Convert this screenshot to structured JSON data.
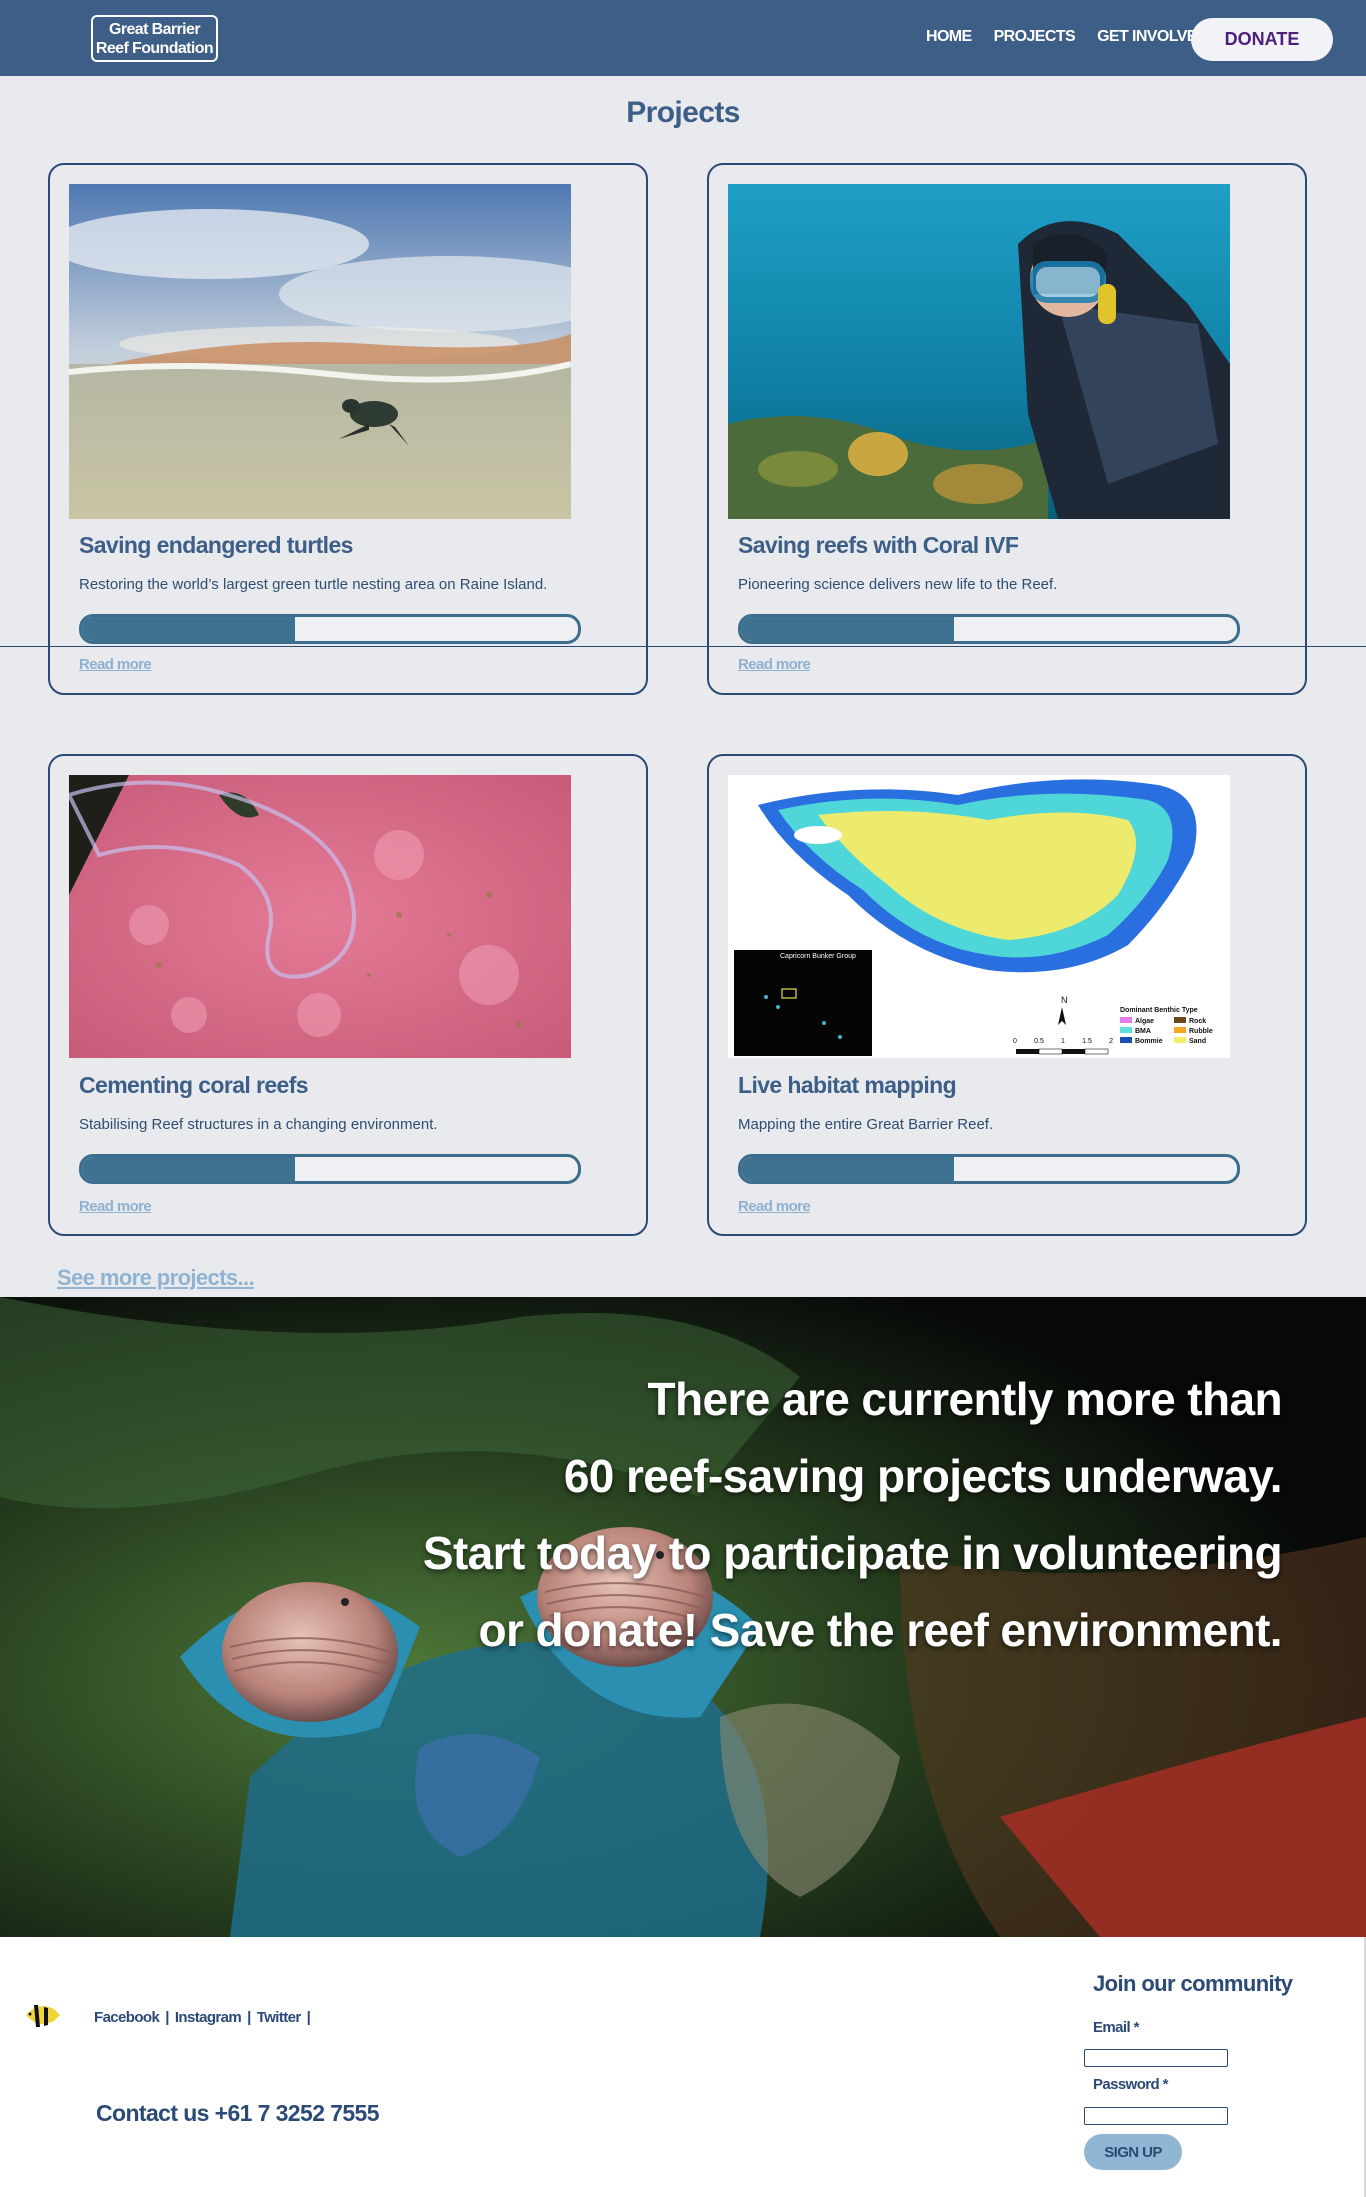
{
  "header": {
    "logo_line1": "Great Barrier",
    "logo_line2": "Reef Foundation",
    "nav": [
      {
        "label": "HOME"
      },
      {
        "label": "PROJECTS"
      },
      {
        "label": "GET INVOLVED"
      }
    ],
    "donate_label": "DONATE"
  },
  "page_title": "Projects",
  "projects": [
    {
      "title": "Saving endangered turtles",
      "description": "Restoring the world’s largest green turtle nesting area on Raine Island.",
      "progress_fraction": 0.43,
      "link": "Read more",
      "image": "turtle-hatchling-photo"
    },
    {
      "title": "Saving reefs with Coral IVF",
      "description": "Pioneering science delivers new life to the Reef.",
      "progress_fraction": 0.43,
      "link": "Read more",
      "image": "scuba-diver-photo"
    },
    {
      "title": "Cementing coral reefs",
      "description": "Stabilising Reef structures in a changing environment.",
      "progress_fraction": 0.43,
      "link": "Read more",
      "image": "pink-coral-photo"
    },
    {
      "title": "Live habitat mapping",
      "description": "Mapping the entire Great Barrier Reef.",
      "progress_fraction": 0.43,
      "link": "Read more",
      "image": "benthic-habitat-map"
    }
  ],
  "map_labels": {
    "inset_title": "Capricorn Bunker Group",
    "north": "N",
    "scale_ticks": [
      "0",
      "0.5",
      "1",
      "1.5",
      "2"
    ],
    "legend_title": "Dominant Benthic Type",
    "legend": [
      {
        "label": "Algae",
        "color": "#e57be8"
      },
      {
        "label": "Rock",
        "color": "#6b4a1e"
      },
      {
        "label": "BMA",
        "color": "#5fe0dc"
      },
      {
        "label": "Rubble",
        "color": "#f5a623"
      },
      {
        "label": "Bommie",
        "color": "#1a4fb0"
      },
      {
        "label": "Sand",
        "color": "#f3ef6a"
      }
    ]
  },
  "see_more": "See more projects...",
  "hero": {
    "lines": [
      "There are currently more than",
      "60 reef-saving projects underway.",
      "Start today to participate in volunteering",
      "or donate! Save the reef environment."
    ]
  },
  "footer": {
    "social": [
      "Facebook",
      "Instagram",
      "Twitter"
    ],
    "separator": "|",
    "contact": "Contact us +61 7 3252 7555",
    "join_title": "Join our community",
    "email_label": "Email",
    "password_label": "Password",
    "required_mark": "*",
    "signup_label": "SIGN UP"
  },
  "colors": {
    "header_bg": "#3d5e87",
    "accent_text": "#3d5e87",
    "progress_fill": "#3f7290",
    "link": "#8fb1d0",
    "donate_text": "#4f1f7e"
  }
}
